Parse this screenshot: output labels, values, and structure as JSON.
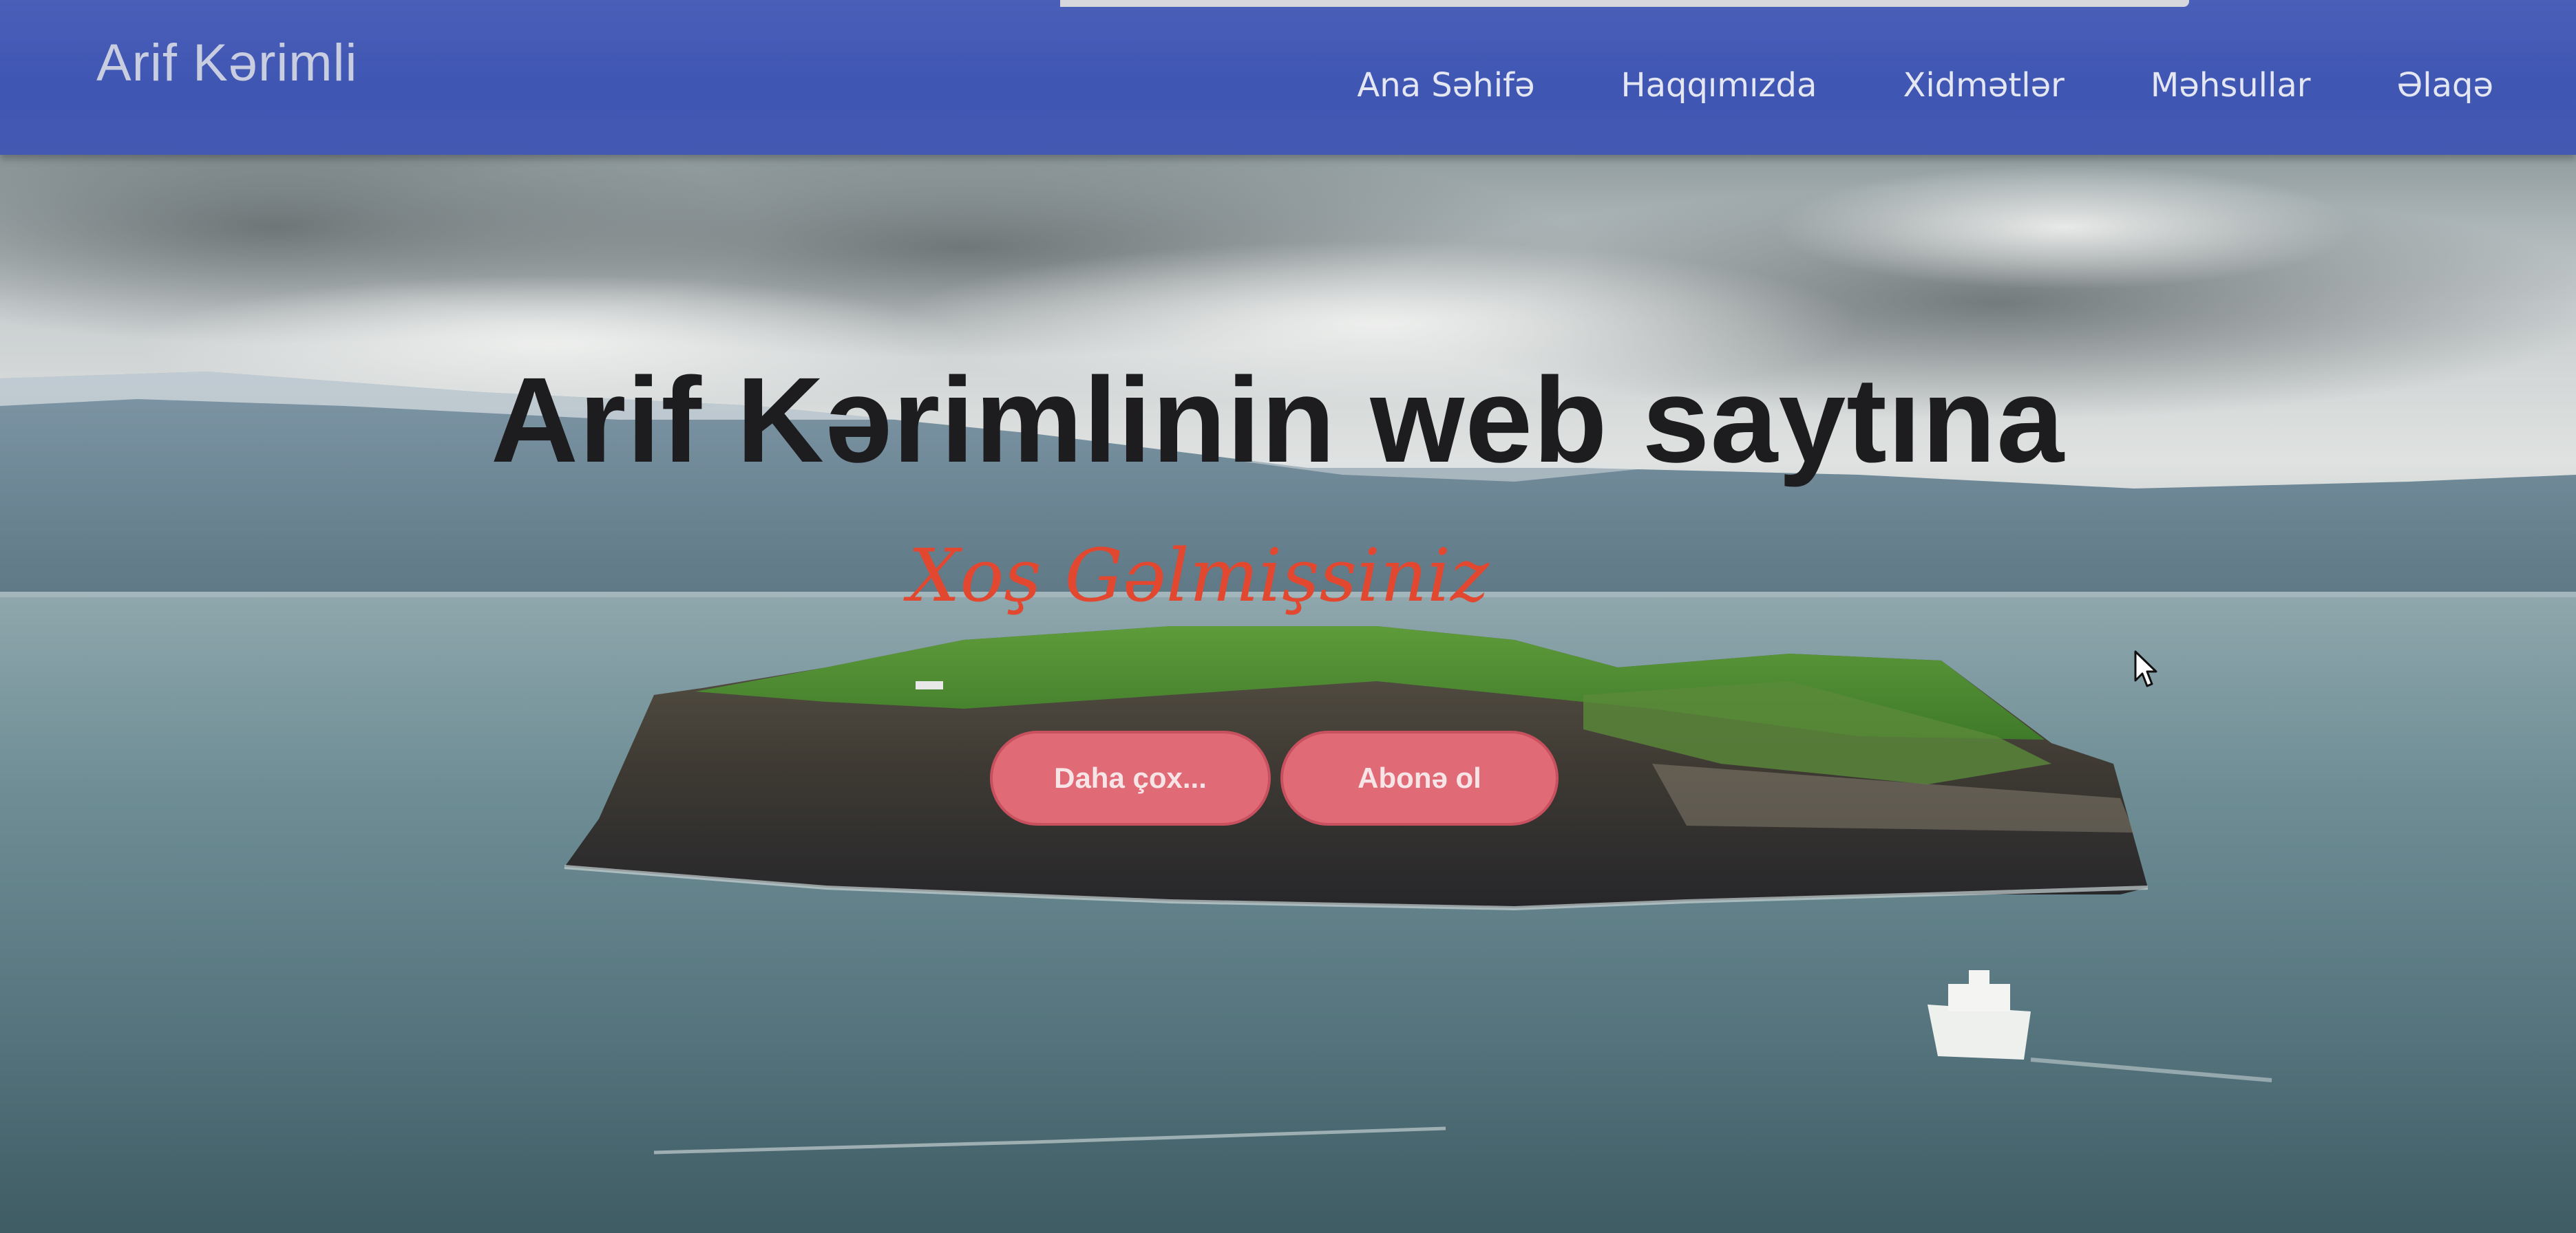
{
  "navbar": {
    "brand": "Arif Kərimli",
    "links": [
      {
        "label": "Ana Səhifə"
      },
      {
        "label": "Haqqımızda"
      },
      {
        "label": "Xidmətlər"
      },
      {
        "label": "Məhsullar"
      },
      {
        "label": "Əlaqə"
      }
    ],
    "background_color": "#3f56b3"
  },
  "hero": {
    "title": "Arif Kərimlinin web saytına",
    "subtitle": "Xoş Gəlmişsiniz",
    "subtitle_color": "#e2472f",
    "buttons": {
      "more_label": "Daha çox...",
      "subscribe_label": "Abonə ol"
    },
    "button_color": "#e06a75"
  },
  "icons": {
    "cursor": "mouse-pointer-icon"
  }
}
